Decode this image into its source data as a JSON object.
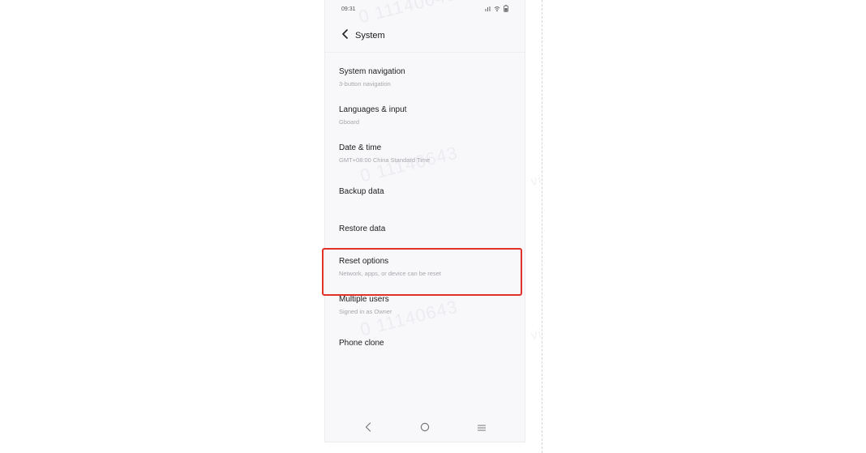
{
  "status_bar": {
    "time": "09:31"
  },
  "header": {
    "title": "System"
  },
  "settings_items": [
    {
      "title": "System navigation",
      "subtitle": "3-button navigation"
    },
    {
      "title": "Languages & input",
      "subtitle": "Gboard"
    },
    {
      "title": "Date & time",
      "subtitle": "GMT+08:00 China Standard Time"
    },
    {
      "title": "Backup data",
      "subtitle": ""
    },
    {
      "title": "Restore data",
      "subtitle": ""
    },
    {
      "title": "Reset options",
      "subtitle": "Network, apps, or device can be reset"
    },
    {
      "title": "Multiple users",
      "subtitle": "Signed in as Owner"
    },
    {
      "title": "Phone clone",
      "subtitle": ""
    }
  ],
  "watermarks": [
    "0 11140643",
    "0 11140643",
    "0 11140643"
  ],
  "colors": {
    "highlight": "#e0322a",
    "screen_background": "#f8f7fa",
    "title_text": "#1c1c1c",
    "subtitle_text": "#a8a8ad"
  },
  "icons": {
    "back": "chevron-left-icon",
    "status": [
      "signal-icon",
      "wifi-icon",
      "battery-icon"
    ],
    "nav": [
      "back-triangle-icon",
      "home-circle-icon",
      "recents-menu-icon"
    ]
  }
}
